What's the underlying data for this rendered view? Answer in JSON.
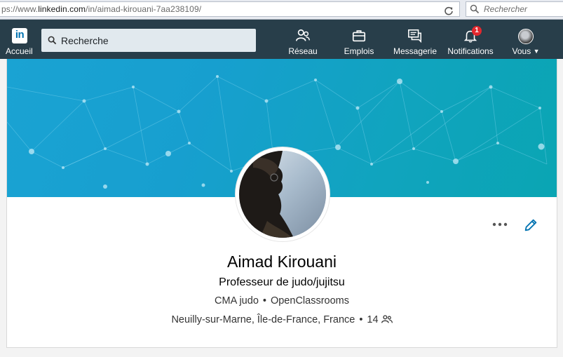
{
  "browser": {
    "url_prefix": "ps://www.",
    "url_domain": "linkedin.com",
    "url_path": "/in/aimad-kirouani-7aa238109/",
    "search_placeholder": "Rechercher"
  },
  "nav": {
    "home_label": "Accueil",
    "logo_text": "in",
    "search_placeholder": "Recherche",
    "items": [
      {
        "label": "Réseau",
        "icon": "network-icon"
      },
      {
        "label": "Emplois",
        "icon": "briefcase-icon"
      },
      {
        "label": "Messagerie",
        "icon": "messaging-icon"
      },
      {
        "label": "Notifications",
        "icon": "bell-icon",
        "badge": "1"
      },
      {
        "label": "Vous",
        "icon": "avatar"
      }
    ]
  },
  "profile": {
    "name": "Aimad Kirouani",
    "headline": "Professeur de judo/jujitsu",
    "company1": "CMA judo",
    "company2": "OpenClassrooms",
    "location": "Neuilly-sur-Marne, Île-de-France, France",
    "connections": "14",
    "separator": "•"
  },
  "colors": {
    "nav_bg": "#283e4a",
    "linkedin_blue": "#0073b1",
    "badge_red": "#e2282e",
    "banner_teal": "#1aa3d3"
  }
}
